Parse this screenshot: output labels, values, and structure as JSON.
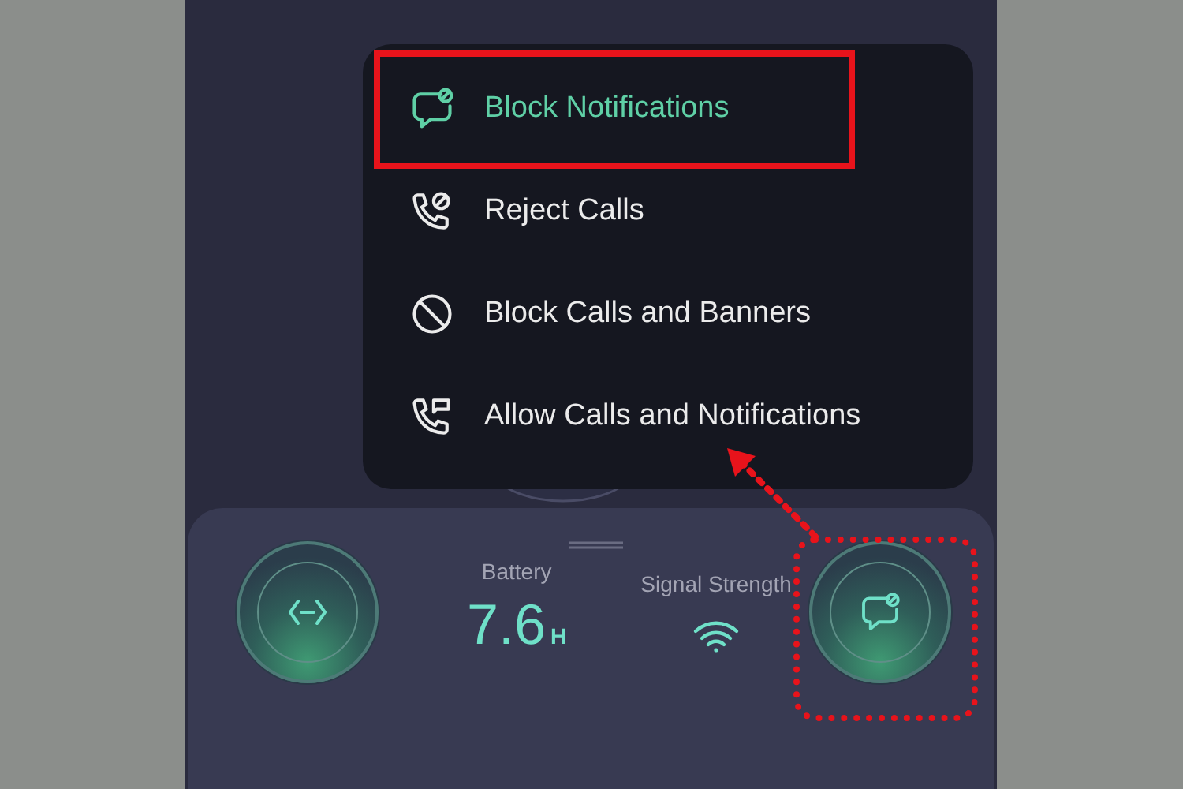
{
  "menu": {
    "items": [
      {
        "label": "Block Notifications",
        "kind": "chat-block",
        "selected": true
      },
      {
        "label": "Reject Calls",
        "kind": "phone-block",
        "selected": false
      },
      {
        "label": "Block Calls and Banners",
        "kind": "block",
        "selected": false
      },
      {
        "label": "Allow Calls and Notifications",
        "kind": "phone-chat",
        "selected": false
      }
    ]
  },
  "status_panel": {
    "battery": {
      "label": "Battery",
      "value": "7.6",
      "unit": "H"
    },
    "signal": {
      "label": "Signal Strength"
    }
  }
}
